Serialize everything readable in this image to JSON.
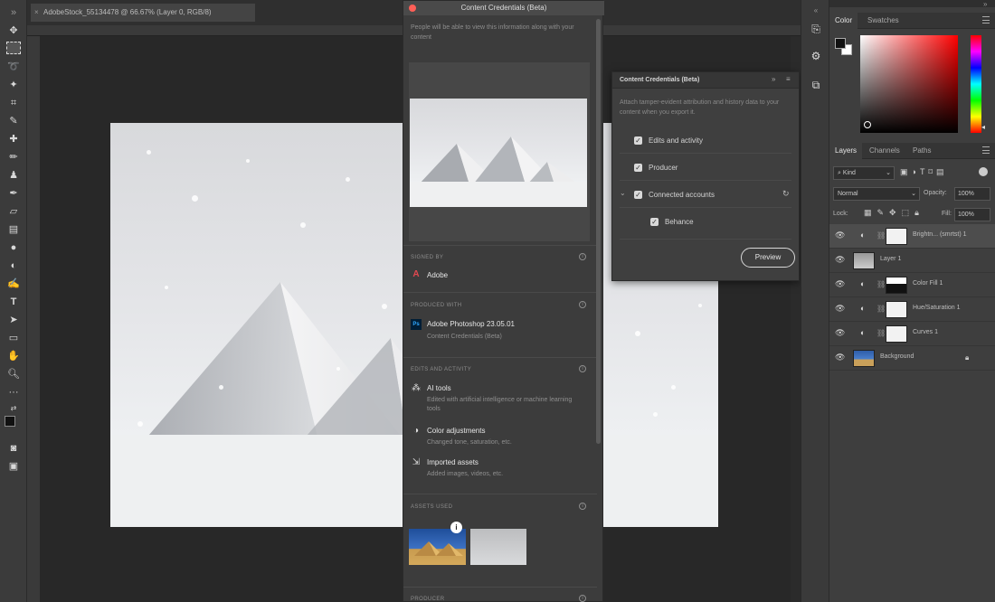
{
  "document": {
    "tab_title": "AdobeStock_55134478 @ 66.67% (Layer 0, RGB/8)"
  },
  "color_panel": {
    "tabs": [
      "Color",
      "Swatches"
    ]
  },
  "layers_panel": {
    "tabs": [
      "Layers",
      "Channels",
      "Paths"
    ],
    "filter_kind": "Kind",
    "blend_mode": "Normal",
    "opacity_label": "Opacity:",
    "opacity_value": "100%",
    "lock_label": "Lock:",
    "fill_label": "Fill:",
    "fill_value": "100%",
    "layers": [
      {
        "name": "Brightn... (smrtst) 1"
      },
      {
        "name": "Layer 1"
      },
      {
        "name": "Color Fill 1"
      },
      {
        "name": "Hue/Saturation 1"
      },
      {
        "name": "Curves 1"
      },
      {
        "name": "Background"
      }
    ]
  },
  "credentials_panel": {
    "title": "Content Credentials (Beta)",
    "intro": "People will be able to view this information along with your content",
    "sections": {
      "signed_by": {
        "label": "SIGNED BY",
        "value": "Adobe"
      },
      "produced_with": {
        "label": "PRODUCED WITH",
        "app": "Adobe Photoshop 23.05.01",
        "sub": "Content Credentials (Beta)"
      },
      "edits": {
        "label": "EDITS AND ACTIVITY",
        "items": [
          {
            "title": "AI tools",
            "sub": "Edited with artificial intelligence or machine learning tools"
          },
          {
            "title": "Color adjustments",
            "sub": "Changed tone, saturation, etc."
          },
          {
            "title": "Imported assets",
            "sub": "Added images, videos, etc."
          }
        ]
      },
      "assets_used": {
        "label": "ASSETS USED"
      },
      "producer": {
        "label": "PRODUCER"
      }
    }
  },
  "flyout": {
    "title": "Content Credentials (Beta)",
    "description": "Attach tamper-evident attribution and history data to your content when you export it.",
    "options": [
      {
        "label": "Edits and activity",
        "checked": true
      },
      {
        "label": "Producer",
        "checked": true
      },
      {
        "label": "Connected accounts",
        "checked": true
      },
      {
        "label": "Behance",
        "checked": true
      }
    ],
    "preview_label": "Preview"
  }
}
